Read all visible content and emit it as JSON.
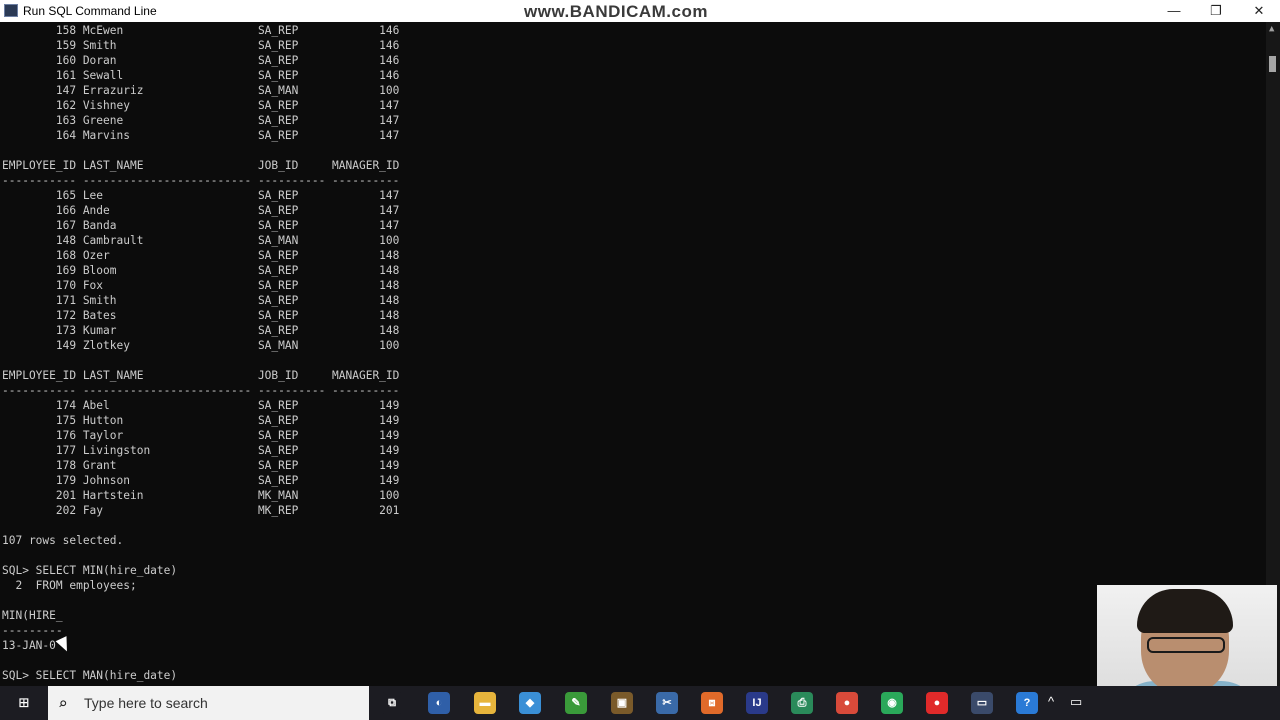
{
  "window": {
    "title": "Run SQL Command Line",
    "watermark": "www.BANDICAM.com",
    "minimize_glyph": "—",
    "restore_glyph": "❐",
    "close_glyph": "✕",
    "icon": "sql-console-icon"
  },
  "terminal": {
    "lines": [
      "        158 McEwen                    SA_REP            146",
      "        159 Smith                     SA_REP            146",
      "        160 Doran                     SA_REP            146",
      "        161 Sewall                    SA_REP            146",
      "        147 Errazuriz                 SA_MAN            100",
      "        162 Vishney                   SA_REP            147",
      "        163 Greene                    SA_REP            147",
      "        164 Marvins                   SA_REP            147",
      "",
      "EMPLOYEE_ID LAST_NAME                 JOB_ID     MANAGER_ID",
      "----------- ------------------------- ---------- ----------",
      "        165 Lee                       SA_REP            147",
      "        166 Ande                      SA_REP            147",
      "        167 Banda                     SA_REP            147",
      "        148 Cambrault                 SA_MAN            100",
      "        168 Ozer                      SA_REP            148",
      "        169 Bloom                     SA_REP            148",
      "        170 Fox                       SA_REP            148",
      "        171 Smith                     SA_REP            148",
      "        172 Bates                     SA_REP            148",
      "        173 Kumar                     SA_REP            148",
      "        149 Zlotkey                   SA_MAN            100",
      "",
      "EMPLOYEE_ID LAST_NAME                 JOB_ID     MANAGER_ID",
      "----------- ------------------------- ---------- ----------",
      "        174 Abel                      SA_REP            149",
      "        175 Hutton                    SA_REP            149",
      "        176 Taylor                    SA_REP            149",
      "        177 Livingston                SA_REP            149",
      "        178 Grant                     SA_REP            149",
      "        179 Johnson                   SA_REP            149",
      "        201 Hartstein                 MK_MAN            100",
      "        202 Fay                       MK_REP            201",
      "",
      "107 rows selected.",
      "",
      "SQL> SELECT MIN(hire_date)",
      "  2  FROM employees;",
      "",
      "MIN(HIRE_",
      "---------",
      "13-JAN-0",
      "",
      "SQL> SELECT MAN(hire_date)"
    ]
  },
  "taskbar": {
    "start_icon": "windows-start-icon",
    "start_glyph": "⊞",
    "search_glyph": "⌕",
    "search_placeholder": "Type here to search",
    "apps": [
      {
        "name": "task-view-icon",
        "glyph": "⧉",
        "color": "#1c1c22"
      },
      {
        "name": "app-icon-1",
        "glyph": "◐",
        "color": "#2f5fa8"
      },
      {
        "name": "file-explorer-icon",
        "glyph": "▬",
        "color": "#e6b43c"
      },
      {
        "name": "app-icon-3",
        "glyph": "◆",
        "color": "#3a8fd6"
      },
      {
        "name": "app-icon-4",
        "glyph": "✎",
        "color": "#3a9a3a"
      },
      {
        "name": "app-icon-5",
        "glyph": "▣",
        "color": "#7a5a2a"
      },
      {
        "name": "app-icon-6",
        "glyph": "✂",
        "color": "#3a6aa8"
      },
      {
        "name": "app-icon-7",
        "glyph": "⧈",
        "color": "#e06a2a"
      },
      {
        "name": "app-icon-8",
        "glyph": "IJ",
        "color": "#2a3a8a"
      },
      {
        "name": "app-icon-9",
        "glyph": "⎙",
        "color": "#2a8a5a"
      },
      {
        "name": "chrome-icon",
        "glyph": "●",
        "color": "#d84a3a"
      },
      {
        "name": "app-icon-11",
        "glyph": "◉",
        "color": "#2aa85a"
      },
      {
        "name": "record-icon",
        "glyph": "●",
        "color": "#e02a2a"
      },
      {
        "name": "sql-console-taskbar-icon",
        "glyph": "▭",
        "color": "#3a4a6a"
      },
      {
        "name": "help-icon",
        "glyph": "?",
        "color": "#2a7ad6"
      }
    ],
    "tray": {
      "chevron_glyph": "^",
      "battery_glyph": "▭"
    }
  }
}
